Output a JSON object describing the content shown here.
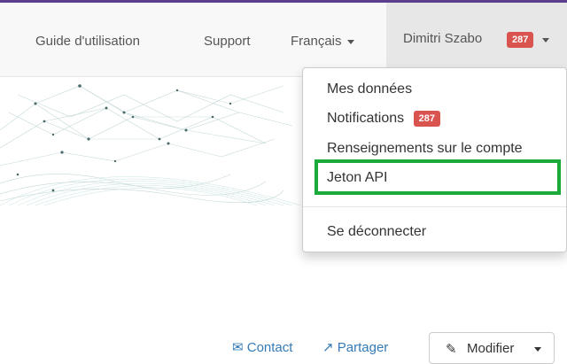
{
  "nav": {
    "guide": "Guide d'utilisation",
    "support": "Support",
    "language": "Français",
    "user_name": "Dimitri Szabo",
    "user_badge": "287"
  },
  "dropdown": {
    "items": [
      {
        "label": "Mes données"
      },
      {
        "label": "Notifications",
        "badge": "287"
      },
      {
        "label": "Renseignements sur le compte"
      },
      {
        "label": "Jeton API"
      },
      {
        "label": "Se déconnecter"
      }
    ]
  },
  "toolbar": {
    "contact": "Contact",
    "share": "Partager",
    "edit": "Modifier"
  },
  "colors": {
    "accent_top": "#5b3f8c",
    "badge": "#d9534f",
    "highlight_box": "#1aaa3a",
    "link": "#337ab7"
  },
  "icons": [
    "caret-down-icon",
    "envelope-icon",
    "share-icon",
    "pencil-icon"
  ]
}
